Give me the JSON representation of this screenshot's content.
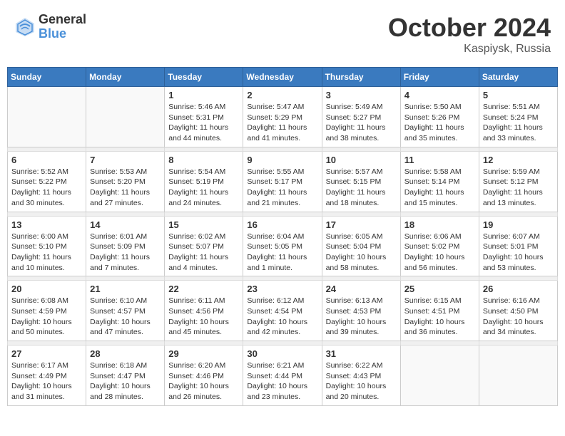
{
  "header": {
    "logo_general": "General",
    "logo_blue": "Blue",
    "month_title": "October 2024",
    "location": "Kaspiysk, Russia"
  },
  "days_of_week": [
    "Sunday",
    "Monday",
    "Tuesday",
    "Wednesday",
    "Thursday",
    "Friday",
    "Saturday"
  ],
  "weeks": [
    [
      {
        "day": "",
        "info": ""
      },
      {
        "day": "",
        "info": ""
      },
      {
        "day": "1",
        "info": "Sunrise: 5:46 AM\nSunset: 5:31 PM\nDaylight: 11 hours and 44 minutes."
      },
      {
        "day": "2",
        "info": "Sunrise: 5:47 AM\nSunset: 5:29 PM\nDaylight: 11 hours and 41 minutes."
      },
      {
        "day": "3",
        "info": "Sunrise: 5:49 AM\nSunset: 5:27 PM\nDaylight: 11 hours and 38 minutes."
      },
      {
        "day": "4",
        "info": "Sunrise: 5:50 AM\nSunset: 5:26 PM\nDaylight: 11 hours and 35 minutes."
      },
      {
        "day": "5",
        "info": "Sunrise: 5:51 AM\nSunset: 5:24 PM\nDaylight: 11 hours and 33 minutes."
      }
    ],
    [
      {
        "day": "6",
        "info": "Sunrise: 5:52 AM\nSunset: 5:22 PM\nDaylight: 11 hours and 30 minutes."
      },
      {
        "day": "7",
        "info": "Sunrise: 5:53 AM\nSunset: 5:20 PM\nDaylight: 11 hours and 27 minutes."
      },
      {
        "day": "8",
        "info": "Sunrise: 5:54 AM\nSunset: 5:19 PM\nDaylight: 11 hours and 24 minutes."
      },
      {
        "day": "9",
        "info": "Sunrise: 5:55 AM\nSunset: 5:17 PM\nDaylight: 11 hours and 21 minutes."
      },
      {
        "day": "10",
        "info": "Sunrise: 5:57 AM\nSunset: 5:15 PM\nDaylight: 11 hours and 18 minutes."
      },
      {
        "day": "11",
        "info": "Sunrise: 5:58 AM\nSunset: 5:14 PM\nDaylight: 11 hours and 15 minutes."
      },
      {
        "day": "12",
        "info": "Sunrise: 5:59 AM\nSunset: 5:12 PM\nDaylight: 11 hours and 13 minutes."
      }
    ],
    [
      {
        "day": "13",
        "info": "Sunrise: 6:00 AM\nSunset: 5:10 PM\nDaylight: 11 hours and 10 minutes."
      },
      {
        "day": "14",
        "info": "Sunrise: 6:01 AM\nSunset: 5:09 PM\nDaylight: 11 hours and 7 minutes."
      },
      {
        "day": "15",
        "info": "Sunrise: 6:02 AM\nSunset: 5:07 PM\nDaylight: 11 hours and 4 minutes."
      },
      {
        "day": "16",
        "info": "Sunrise: 6:04 AM\nSunset: 5:05 PM\nDaylight: 11 hours and 1 minute."
      },
      {
        "day": "17",
        "info": "Sunrise: 6:05 AM\nSunset: 5:04 PM\nDaylight: 10 hours and 58 minutes."
      },
      {
        "day": "18",
        "info": "Sunrise: 6:06 AM\nSunset: 5:02 PM\nDaylight: 10 hours and 56 minutes."
      },
      {
        "day": "19",
        "info": "Sunrise: 6:07 AM\nSunset: 5:01 PM\nDaylight: 10 hours and 53 minutes."
      }
    ],
    [
      {
        "day": "20",
        "info": "Sunrise: 6:08 AM\nSunset: 4:59 PM\nDaylight: 10 hours and 50 minutes."
      },
      {
        "day": "21",
        "info": "Sunrise: 6:10 AM\nSunset: 4:57 PM\nDaylight: 10 hours and 47 minutes."
      },
      {
        "day": "22",
        "info": "Sunrise: 6:11 AM\nSunset: 4:56 PM\nDaylight: 10 hours and 45 minutes."
      },
      {
        "day": "23",
        "info": "Sunrise: 6:12 AM\nSunset: 4:54 PM\nDaylight: 10 hours and 42 minutes."
      },
      {
        "day": "24",
        "info": "Sunrise: 6:13 AM\nSunset: 4:53 PM\nDaylight: 10 hours and 39 minutes."
      },
      {
        "day": "25",
        "info": "Sunrise: 6:15 AM\nSunset: 4:51 PM\nDaylight: 10 hours and 36 minutes."
      },
      {
        "day": "26",
        "info": "Sunrise: 6:16 AM\nSunset: 4:50 PM\nDaylight: 10 hours and 34 minutes."
      }
    ],
    [
      {
        "day": "27",
        "info": "Sunrise: 6:17 AM\nSunset: 4:49 PM\nDaylight: 10 hours and 31 minutes."
      },
      {
        "day": "28",
        "info": "Sunrise: 6:18 AM\nSunset: 4:47 PM\nDaylight: 10 hours and 28 minutes."
      },
      {
        "day": "29",
        "info": "Sunrise: 6:20 AM\nSunset: 4:46 PM\nDaylight: 10 hours and 26 minutes."
      },
      {
        "day": "30",
        "info": "Sunrise: 6:21 AM\nSunset: 4:44 PM\nDaylight: 10 hours and 23 minutes."
      },
      {
        "day": "31",
        "info": "Sunrise: 6:22 AM\nSunset: 4:43 PM\nDaylight: 10 hours and 20 minutes."
      },
      {
        "day": "",
        "info": ""
      },
      {
        "day": "",
        "info": ""
      }
    ]
  ]
}
